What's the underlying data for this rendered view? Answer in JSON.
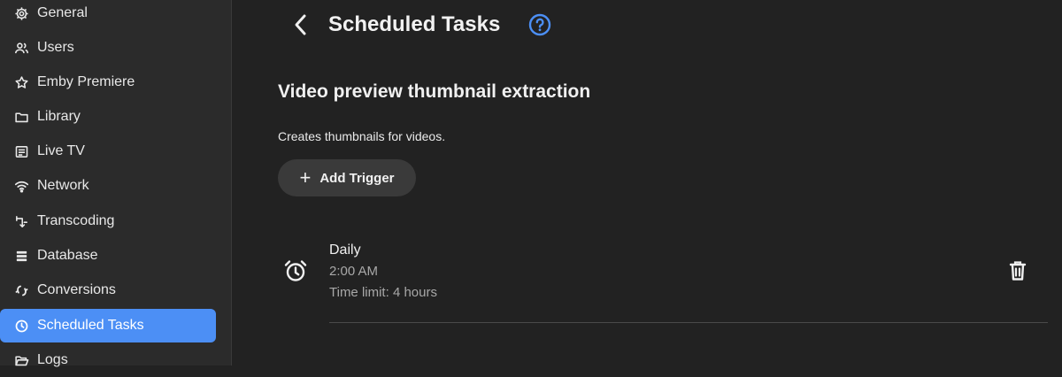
{
  "sidebar": {
    "items": [
      {
        "label": "General",
        "icon": "gear-icon"
      },
      {
        "label": "Users",
        "icon": "users-icon"
      },
      {
        "label": "Emby Premiere",
        "icon": "star-icon"
      },
      {
        "label": "Library",
        "icon": "folder-icon"
      },
      {
        "label": "Live TV",
        "icon": "tv-guide-icon"
      },
      {
        "label": "Network",
        "icon": "wifi-icon"
      },
      {
        "label": "Transcoding",
        "icon": "transcode-icon"
      },
      {
        "label": "Database",
        "icon": "database-icon"
      },
      {
        "label": "Conversions",
        "icon": "sync-icon"
      },
      {
        "label": "Scheduled Tasks",
        "icon": "clock-icon",
        "active": true
      },
      {
        "label": "Logs",
        "icon": "folder-open-icon"
      }
    ],
    "active_color": "#4c8ff5"
  },
  "header": {
    "title": "Scheduled Tasks",
    "back_icon": "chevron-left-icon",
    "help_icon": "help-circle-icon"
  },
  "task": {
    "name": "Video preview thumbnail extraction",
    "description": "Creates thumbnails for videos.",
    "add_trigger_label": "Add Trigger"
  },
  "triggers": [
    {
      "title": "Daily",
      "time": "2:00 AM",
      "limit": "Time limit: 4 hours",
      "icon": "alarm-icon",
      "delete_icon": "trash-icon"
    }
  ]
}
